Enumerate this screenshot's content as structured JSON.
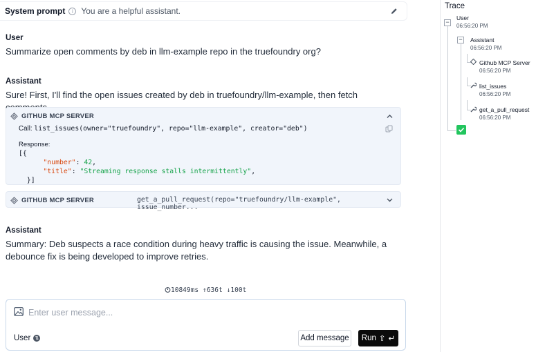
{
  "system_prompt": {
    "label": "System prompt",
    "info_icon": "info-icon",
    "value": "You are a helpful assistant.",
    "edit_icon": "pencil-icon"
  },
  "conversation": {
    "user_role": "User",
    "user_text": "Summarize open comments by deb in llm-example repo in the truefoundry org?",
    "assistant_role_1": "Assistant",
    "assistant_text_1": "Sure! First, I'll find the open issues created by deb in truefoundry/llm-example, then fetch comments.",
    "tool_call_1": {
      "server": "GITHUB MCP SERVER",
      "call_label": "Call:",
      "call": "list_issues(owner=\"truefoundry\", repo=\"llm-example\", creator=\"deb\")",
      "response_label": "Response:",
      "json_open": "[{",
      "key_number": "\"number\"",
      "val_number": "42",
      "key_title": "\"title\"",
      "val_title": "\"Streaming response stalls intermittently\"",
      "json_close": "}]",
      "expanded": true
    },
    "tool_call_2": {
      "server": "GITHUB MCP SERVER",
      "call": "get_a_pull_request(repo=\"truefoundry/llm-example\", issue_number...",
      "expanded": false
    },
    "assistant_role_2": "Assistant",
    "assistant_text_2": "Summary: Deb suspects a race condition during heavy traffic is causing the issue. Meanwhile, a debounce fix is being developed to improve retries."
  },
  "stats": {
    "latency": "10849ms",
    "tokens_up": "636t",
    "tokens_down": "100t"
  },
  "composer": {
    "placeholder": "Enter user message...",
    "role": "User",
    "add_label": "Add message",
    "run_label": "Run"
  },
  "trace": {
    "title": "Trace",
    "nodes": [
      {
        "label": "User",
        "time": "06:56:20 PM"
      },
      {
        "label": "Assistant",
        "time": "06:56:20 PM"
      },
      {
        "label": "Github MCP Server",
        "time": "06:56:20 PM"
      },
      {
        "label": "list_issues",
        "time": "06:56:20 PM"
      },
      {
        "label": "get_a_pull_request",
        "time": "06:56:20 PM"
      }
    ],
    "complete_color": "#22c55e"
  }
}
